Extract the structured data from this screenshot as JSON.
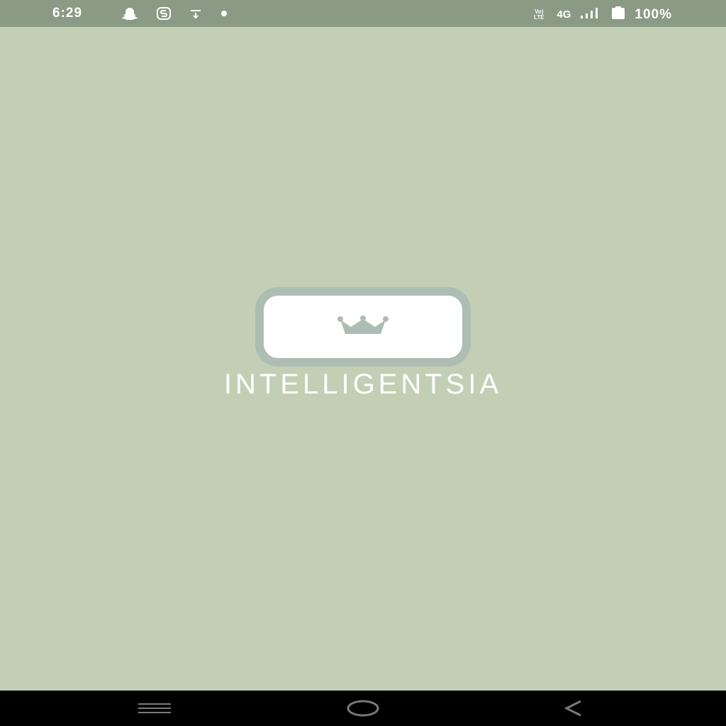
{
  "status_bar": {
    "time": "6:29",
    "left_icons": [
      "snapchat-icon",
      "s-app-icon",
      "download-icon",
      "dot-icon"
    ],
    "volte_line1": "Vo)",
    "volte_line2": "LTE",
    "network": "4G",
    "battery_percent": "100%"
  },
  "splash": {
    "app_name": "INTELLIGENTSIA",
    "logo_icon": "crown-icon"
  },
  "nav_bar": {
    "buttons": [
      "recent-apps",
      "home",
      "back"
    ]
  },
  "colors": {
    "background": "#c2cfb4",
    "status_bar": "#8a9a84",
    "logo_border": "#aebdb4",
    "crown": "#aebdb4",
    "nav_bar": "#000000"
  }
}
